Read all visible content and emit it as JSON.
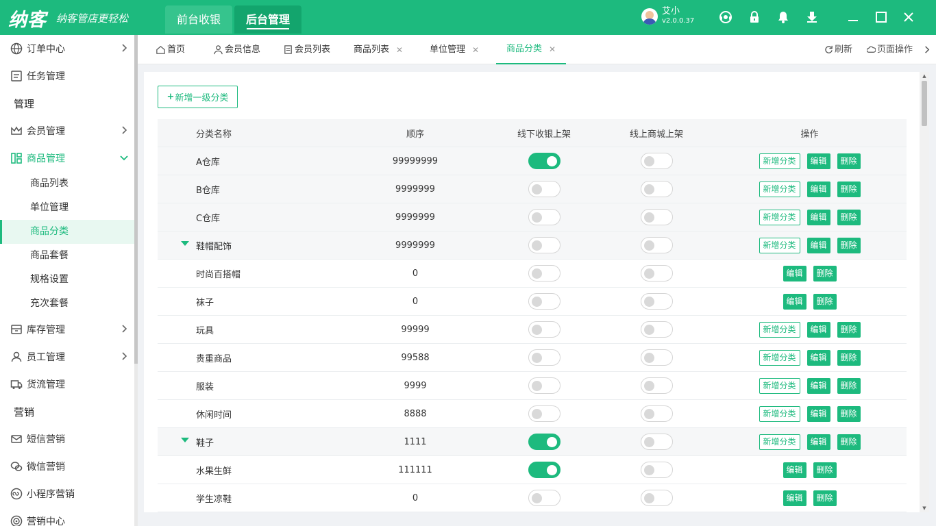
{
  "header": {
    "logo_text": "纳客",
    "slogan": "纳客管店更轻松",
    "tabs": [
      {
        "label": "前台收银",
        "active": false
      },
      {
        "label": "后台管理",
        "active": true
      }
    ],
    "user_name": "艾小",
    "version": "v2.0.0.37",
    "icons": [
      "headset-icon",
      "lock-icon",
      "bell-icon",
      "download-icon",
      "minimize-icon",
      "maximize-icon",
      "close-icon"
    ]
  },
  "sidebar": {
    "items": [
      {
        "label": "订单中心",
        "icon": "globe-icon",
        "expandable": true
      },
      {
        "label": "任务管理",
        "icon": "task-icon",
        "expandable": false
      },
      {
        "label": "管理",
        "type": "group-title"
      },
      {
        "label": "会员管理",
        "icon": "crown-icon",
        "expandable": true
      },
      {
        "label": "商品管理",
        "icon": "goods-icon",
        "expandable": true,
        "expanded": true
      },
      {
        "label": "库存管理",
        "icon": "stock-icon",
        "expandable": true
      },
      {
        "label": "员工管理",
        "icon": "user-icon",
        "expandable": true
      },
      {
        "label": "货流管理",
        "icon": "truck-icon",
        "expandable": false
      },
      {
        "label": "营销",
        "type": "group-title"
      },
      {
        "label": "短信营销",
        "icon": "mail-icon",
        "expandable": false
      },
      {
        "label": "微信营销",
        "icon": "wechat-icon",
        "expandable": false
      },
      {
        "label": "小程序营销",
        "icon": "miniapp-icon",
        "expandable": false
      },
      {
        "label": "营销中心",
        "icon": "target-icon",
        "expandable": false
      }
    ],
    "sub_items": [
      {
        "label": "商品列表",
        "active": false
      },
      {
        "label": "单位管理",
        "active": false
      },
      {
        "label": "商品分类",
        "active": true
      },
      {
        "label": "商品套餐",
        "active": false
      },
      {
        "label": "规格设置",
        "active": false
      },
      {
        "label": "充次套餐",
        "active": false
      }
    ]
  },
  "page_tabs": {
    "tabs": [
      {
        "label": "首页",
        "icon": "home-icon",
        "closable": false
      },
      {
        "label": "会员信息",
        "icon": "member-icon",
        "closable": false
      },
      {
        "label": "会员列表",
        "icon": "list-icon",
        "closable": false
      },
      {
        "label": "商品列表",
        "closable": true
      },
      {
        "label": "单位管理",
        "closable": true
      },
      {
        "label": "商品分类",
        "closable": true,
        "active": true
      }
    ],
    "refresh_label": "刷新",
    "page_ops_label": "页面操作",
    "close_mark": "✕"
  },
  "main": {
    "add_button_label": "新增一级分类",
    "columns": [
      "分类名称",
      "顺序",
      "线下收银上架",
      "线上商城上架",
      "操作"
    ],
    "op_labels": {
      "add": "新增分类",
      "edit": "编辑",
      "delete": "删除"
    },
    "rows": [
      {
        "name": "A仓库",
        "order": "99999999",
        "offline": true,
        "online": false,
        "can_add": true,
        "expanded": false,
        "parent": true
      },
      {
        "name": "B仓库",
        "order": "9999999",
        "offline": false,
        "online": false,
        "can_add": true,
        "expanded": false,
        "parent": true
      },
      {
        "name": "C仓库",
        "order": "9999999",
        "offline": false,
        "online": false,
        "can_add": true,
        "expanded": false,
        "parent": true
      },
      {
        "name": "鞋帽配饰",
        "order": "9999999",
        "offline": false,
        "online": false,
        "can_add": true,
        "expanded": true,
        "parent": true
      },
      {
        "name": "时尚百搭帽",
        "order": "0",
        "offline": false,
        "online": false,
        "can_add": false,
        "expanded": false,
        "parent": false
      },
      {
        "name": "袜子",
        "order": "0",
        "offline": false,
        "online": false,
        "can_add": false,
        "expanded": false,
        "parent": false
      },
      {
        "name": "玩具",
        "order": "99999",
        "offline": false,
        "online": false,
        "can_add": true,
        "expanded": false,
        "parent": false
      },
      {
        "name": "贵重商品",
        "order": "99588",
        "offline": false,
        "online": false,
        "can_add": true,
        "expanded": false,
        "parent": false
      },
      {
        "name": "服装",
        "order": "9999",
        "offline": false,
        "online": false,
        "can_add": true,
        "expanded": false,
        "parent": false
      },
      {
        "name": "休闲时间",
        "order": "8888",
        "offline": false,
        "online": false,
        "can_add": true,
        "expanded": false,
        "parent": false
      },
      {
        "name": "鞋子",
        "order": "1111",
        "offline": true,
        "online": false,
        "can_add": true,
        "expanded": true,
        "parent": true
      },
      {
        "name": "水果生鲜",
        "order": "111111",
        "offline": true,
        "online": false,
        "can_add": false,
        "expanded": false,
        "parent": false
      },
      {
        "name": "学生凉鞋",
        "order": "0",
        "offline": false,
        "online": false,
        "can_add": false,
        "expanded": false,
        "parent": false
      }
    ]
  },
  "colors": {
    "brand": "#1dba7e",
    "brand_dark": "#13a56d"
  }
}
